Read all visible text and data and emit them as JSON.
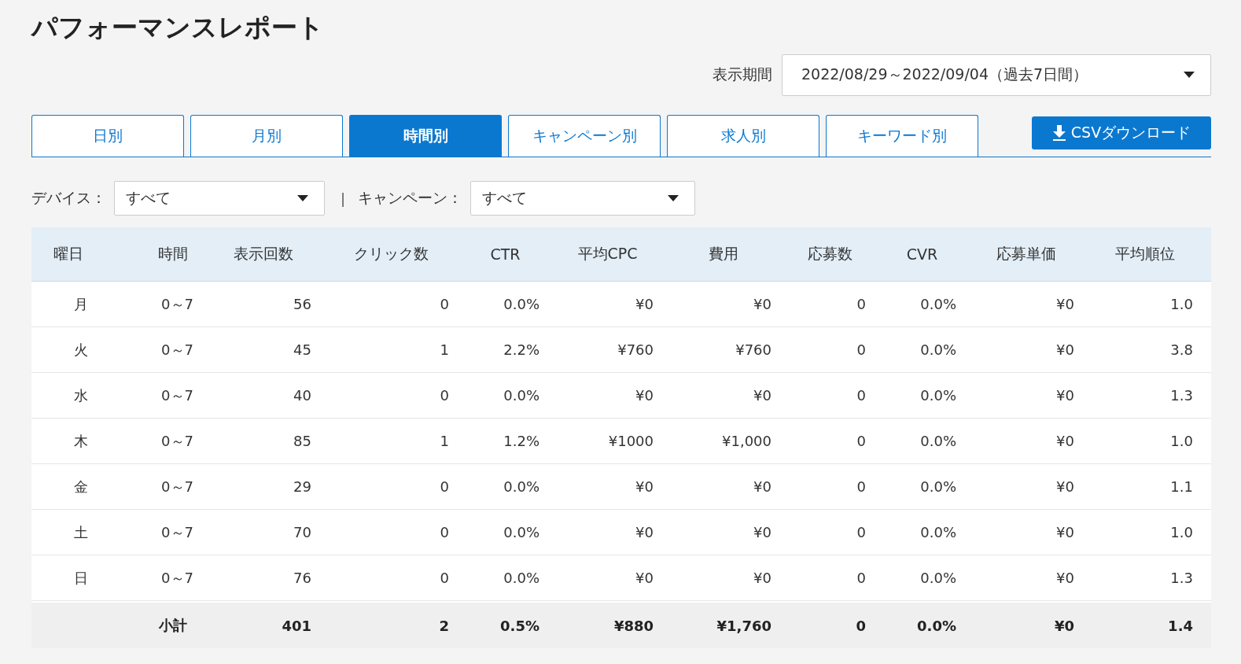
{
  "title": "パフォーマンスレポート",
  "period": {
    "label": "表示期間",
    "value": "2022/08/29～2022/09/04（過去7日間）"
  },
  "tabs": [
    {
      "label": "日別",
      "selected": false
    },
    {
      "label": "月別",
      "selected": false
    },
    {
      "label": "時間別",
      "selected": true
    },
    {
      "label": "キャンペーン別",
      "selected": false
    },
    {
      "label": "求人別",
      "selected": false
    },
    {
      "label": "キーワード別",
      "selected": false
    }
  ],
  "csv_button": "CSVダウンロード",
  "filters": [
    {
      "label": "デバイス：",
      "value": "すべて"
    },
    {
      "label": "キャンペーン：",
      "value": "すべて"
    }
  ],
  "filter_separator": "|",
  "table": {
    "columns": [
      "曜日",
      "時間",
      "表示回数",
      "クリック数",
      "CTR",
      "平均CPC",
      "費用",
      "応募数",
      "CVR",
      "応募単価",
      "平均順位"
    ],
    "rows": [
      [
        "月",
        "0～7",
        "56",
        "0",
        "0.0%",
        "¥0",
        "¥0",
        "0",
        "0.0%",
        "¥0",
        "1.0"
      ],
      [
        "火",
        "0～7",
        "45",
        "1",
        "2.2%",
        "¥760",
        "¥760",
        "0",
        "0.0%",
        "¥0",
        "3.8"
      ],
      [
        "水",
        "0～7",
        "40",
        "0",
        "0.0%",
        "¥0",
        "¥0",
        "0",
        "0.0%",
        "¥0",
        "1.3"
      ],
      [
        "木",
        "0～7",
        "85",
        "1",
        "1.2%",
        "¥1000",
        "¥1,000",
        "0",
        "0.0%",
        "¥0",
        "1.0"
      ],
      [
        "金",
        "0～7",
        "29",
        "0",
        "0.0%",
        "¥0",
        "¥0",
        "0",
        "0.0%",
        "¥0",
        "1.1"
      ],
      [
        "土",
        "0～7",
        "70",
        "0",
        "0.0%",
        "¥0",
        "¥0",
        "0",
        "0.0%",
        "¥0",
        "1.0"
      ],
      [
        "日",
        "0～7",
        "76",
        "0",
        "0.0%",
        "¥0",
        "¥0",
        "0",
        "0.0%",
        "¥0",
        "1.3"
      ]
    ],
    "subtotal": {
      "label": "小計",
      "cells": [
        "401",
        "2",
        "0.5%",
        "¥880",
        "¥1,760",
        "0",
        "0.0%",
        "¥0",
        "1.4"
      ]
    }
  }
}
